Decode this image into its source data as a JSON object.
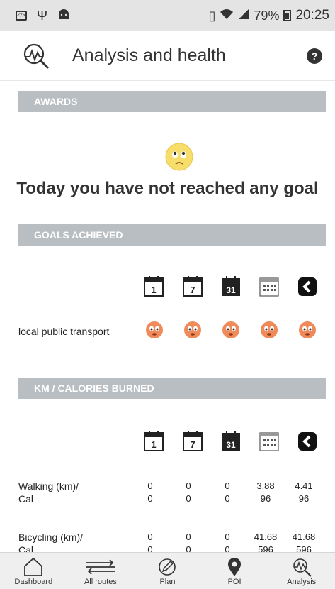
{
  "status_bar": {
    "battery": "79%",
    "time": "20:25",
    "icons": [
      "code-icon",
      "usb-icon",
      "android-icon",
      "vibrate-icon",
      "wifi-icon",
      "signal-icon",
      "battery-charging-icon"
    ]
  },
  "header": {
    "title": "Analysis and health",
    "help_label": "?"
  },
  "awards": {
    "section_title": "AWARDS",
    "message": "Today you have not reached any goal"
  },
  "goals": {
    "section_title": "GOALS ACHIEVED",
    "periods": [
      "1",
      "7",
      "31",
      "calendar",
      "total"
    ],
    "rows": [
      {
        "label": "local public transport"
      }
    ]
  },
  "km": {
    "section_title": "KM / CALORIES BURNED",
    "periods": [
      "1",
      "7",
      "31",
      "calendar",
      "total"
    ],
    "rows": [
      {
        "label_line1": "Walking (km)/",
        "label_line2": "Cal",
        "km": [
          "0",
          "0",
          "0",
          "3.88",
          "4.41"
        ],
        "cal": [
          "0",
          "0",
          "0",
          "96",
          "96"
        ]
      },
      {
        "label_line1": "Bicycling (km)/",
        "label_line2": "Cal",
        "km": [
          "0",
          "0",
          "0",
          "41.68",
          "41.68"
        ],
        "cal": [
          "0",
          "0",
          "0",
          "596",
          "596"
        ]
      }
    ]
  },
  "bottom_nav": [
    {
      "label": "Dashboard",
      "icon": "house-icon"
    },
    {
      "label": "All routes",
      "icon": "routes-icon"
    },
    {
      "label": "Plan",
      "icon": "pencil-circle-icon"
    },
    {
      "label": "POI",
      "icon": "pin-icon"
    },
    {
      "label": "Analysis",
      "icon": "analysis-icon"
    }
  ],
  "colors": {
    "section_bar": "#b8bec1",
    "face_fill": "#f08a5a",
    "sad_face": "#f7dd6a"
  }
}
